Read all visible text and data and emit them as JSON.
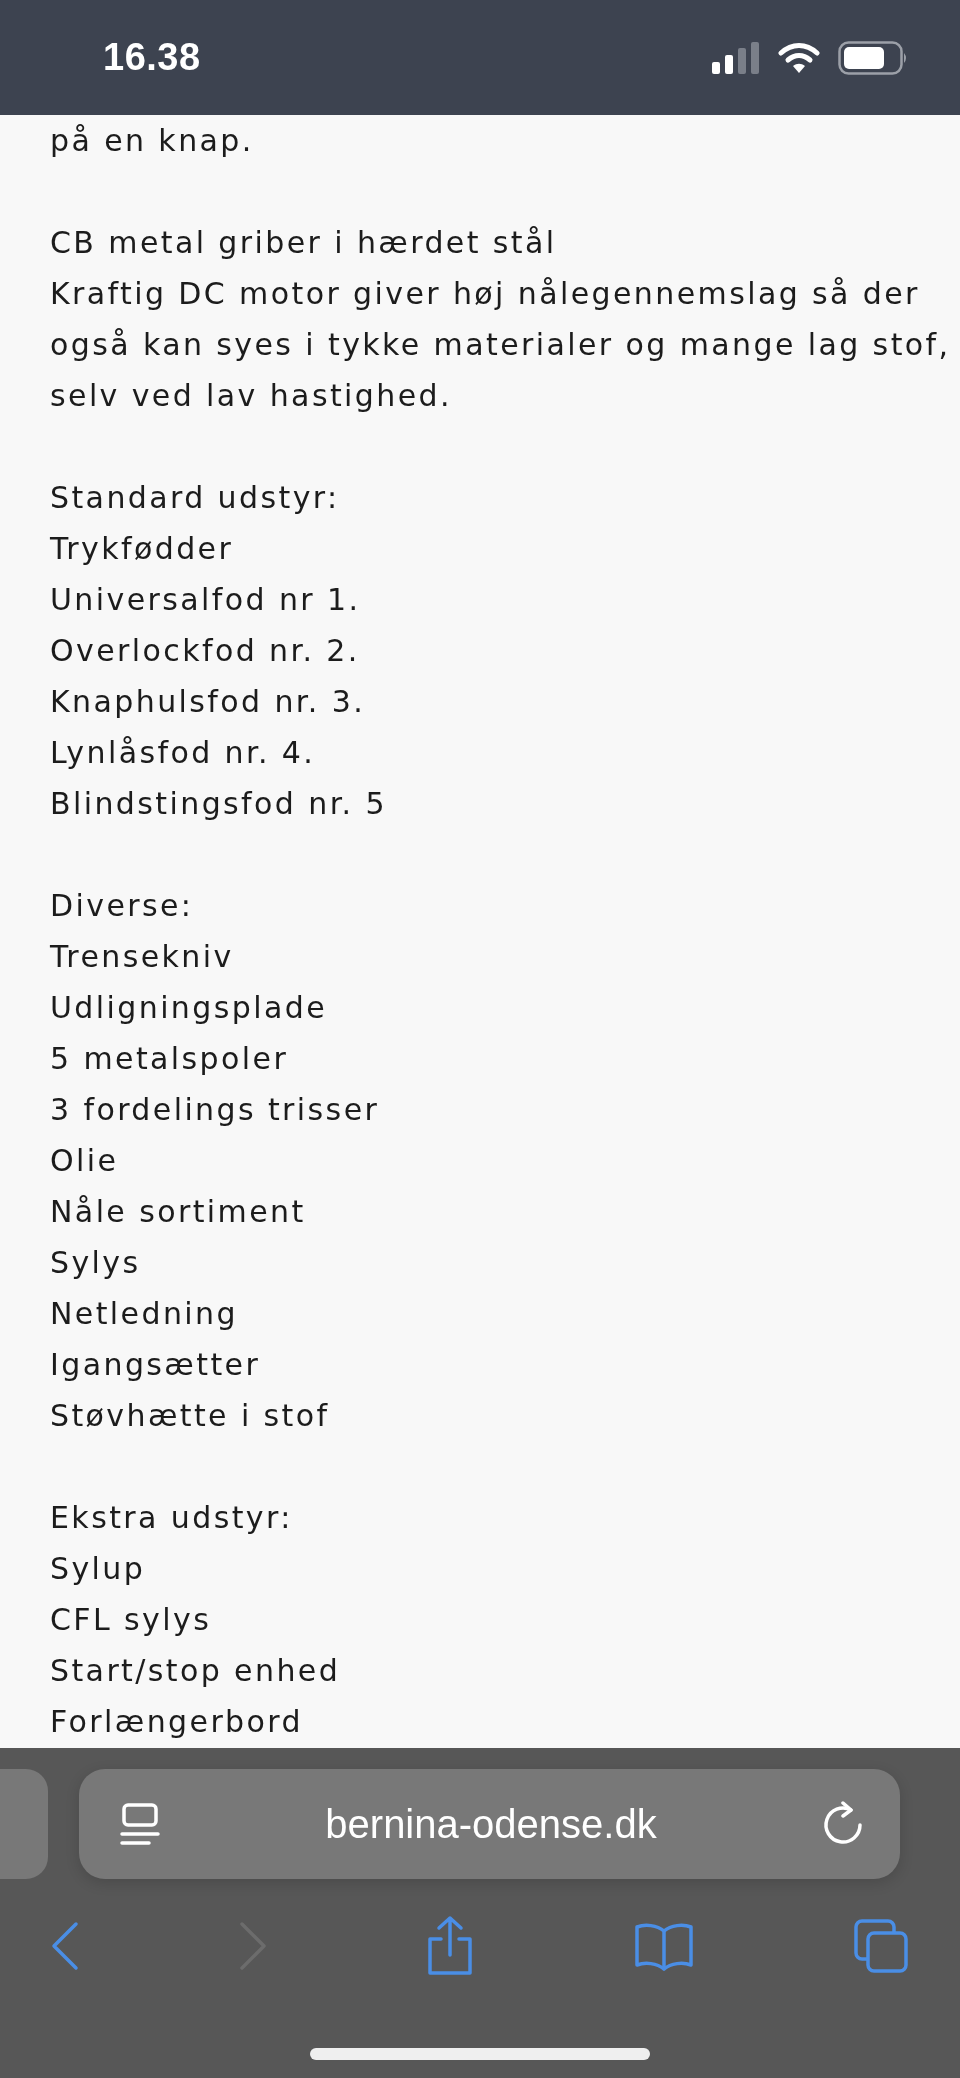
{
  "status_bar": {
    "time": "16.38"
  },
  "article": {
    "paragraphs": [
      {
        "lines": [
          "på en knap."
        ]
      },
      {
        "lines": [
          "CB metal griber i hærdet stål",
          "Kraftig DC motor giver høj nålegennemslag så der også kan syes i tykke materialer og mange lag stof, selv ved lav hastighed."
        ]
      },
      {
        "lines": [
          "Standard udstyr:",
          "Trykfødder",
          "Universalfod nr 1.",
          "Overlockfod nr. 2.",
          "Knaphulsfod nr. 3.",
          "Lynlåsfod nr. 4.",
          "Blindstingsfod nr. 5"
        ]
      },
      {
        "lines": [
          "Diverse:",
          "Trensekniv",
          "Udligningsplade",
          "5 metalspoler",
          "3 fordelings trisser",
          "Olie",
          "Nåle sortiment",
          "Sylys",
          "Netledning",
          "Igangsætter",
          "Støvhætte i stof"
        ]
      },
      {
        "lines": [
          "Ekstra udstyr:",
          "Sylup",
          "CFL sylys",
          "Start/stop enhed",
          "Forlængerbord"
        ]
      }
    ]
  },
  "address_bar": {
    "url": "bernina-odense.dk"
  },
  "toolbar": {
    "buttons": [
      {
        "kind": "back",
        "disabled": false
      },
      {
        "kind": "forward",
        "disabled": true
      },
      {
        "kind": "share",
        "disabled": false
      },
      {
        "kind": "bookmarks",
        "disabled": false
      },
      {
        "kind": "tabs",
        "disabled": false
      }
    ]
  }
}
